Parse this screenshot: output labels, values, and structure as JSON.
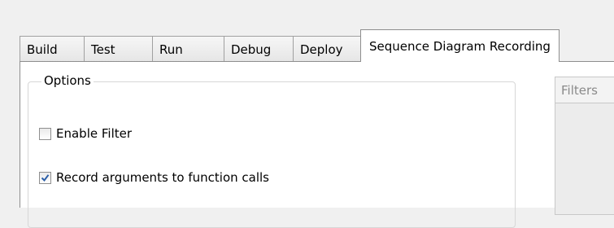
{
  "tabs": [
    {
      "label": "Build",
      "active": false
    },
    {
      "label": "Test",
      "active": false
    },
    {
      "label": "Run",
      "active": false
    },
    {
      "label": "Debug",
      "active": false
    },
    {
      "label": "Deploy",
      "active": false
    },
    {
      "label": "Sequence Diagram Recording",
      "active": true
    }
  ],
  "options": {
    "title": "Options",
    "enable_filter": {
      "label": "Enable Filter",
      "checked": false
    },
    "record_arguments": {
      "label": "Record arguments to function calls",
      "checked": true
    }
  },
  "filters": {
    "label": "Filters"
  },
  "colors": {
    "tab_border": "#a0a0a0",
    "panel_background": "#ffffff",
    "group_border": "#d7d7d7",
    "filters_text": "#8a8a8a",
    "check_mark": "#2b5ea7"
  }
}
